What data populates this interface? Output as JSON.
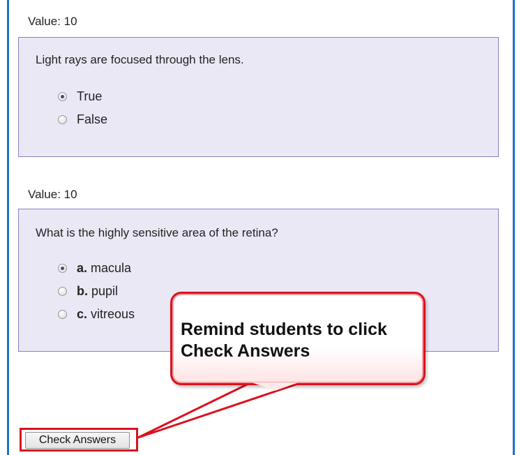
{
  "questions": [
    {
      "value_label": "Value: 10",
      "prompt": "Light rays are focused through the lens.",
      "options": [
        {
          "letter": "",
          "label": "True",
          "selected": true
        },
        {
          "letter": "",
          "label": "False",
          "selected": false
        }
      ]
    },
    {
      "value_label": "Value: 10",
      "prompt": "What is the highly sensitive area of the retina?",
      "options": [
        {
          "letter": "a.",
          "label": "macula",
          "selected": true
        },
        {
          "letter": "b.",
          "label": "pupil",
          "selected": false
        },
        {
          "letter": "c.",
          "label": "vitreous",
          "selected": false
        }
      ]
    }
  ],
  "callout": {
    "text": "Remind students to click Check Answers"
  },
  "check_answers_label": "Check Answers",
  "colors": {
    "question_box_bg": "#ebe8f5",
    "question_box_border": "#8c7fc4",
    "callout_border": "#d9131f",
    "frame_border": "#1d6fd1"
  }
}
